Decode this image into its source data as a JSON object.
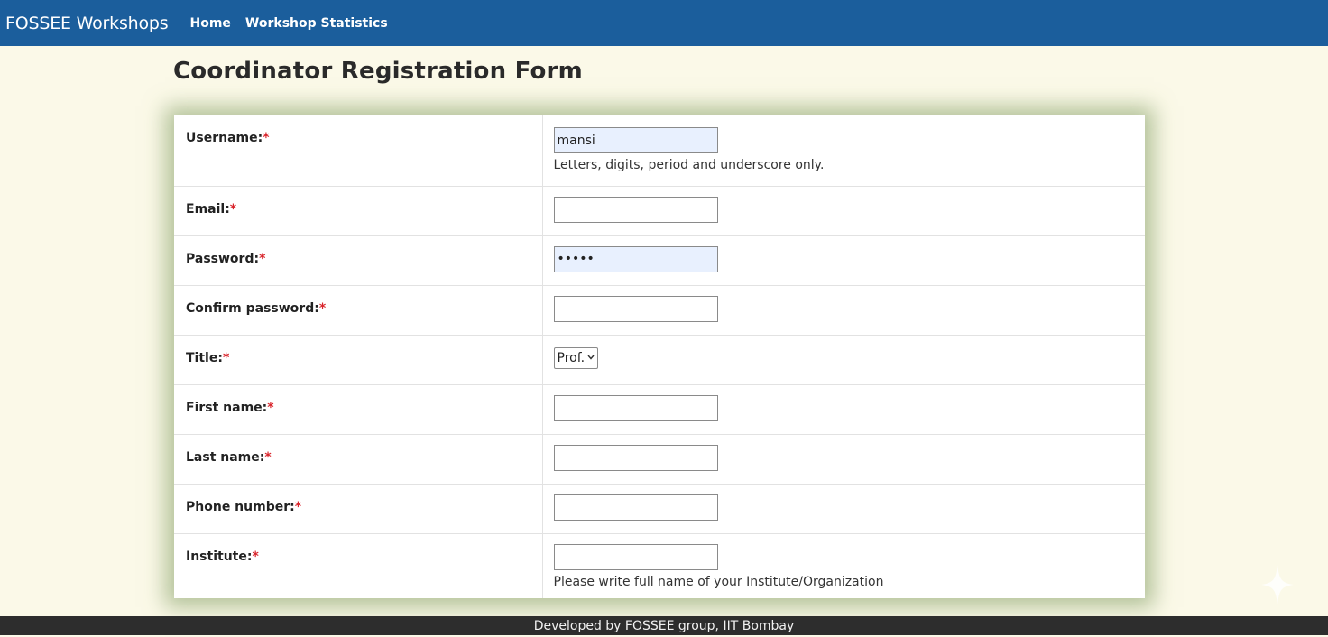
{
  "navbar": {
    "brand": "FOSSEE Workshops",
    "links": [
      "Home",
      "Workshop Statistics"
    ]
  },
  "page": {
    "title": "Coordinator Registration Form"
  },
  "form": {
    "required_mark": "*",
    "fields": [
      {
        "label": "Username:",
        "value": "mansi",
        "help": "Letters, digits, period and underscore only."
      },
      {
        "label": "Email:",
        "value": ""
      },
      {
        "label": "Password:",
        "value": "•••••"
      },
      {
        "label": "Confirm password:",
        "value": ""
      },
      {
        "label": "Title:",
        "selected": "Prof."
      },
      {
        "label": "First name:",
        "value": ""
      },
      {
        "label": "Last name:",
        "value": ""
      },
      {
        "label": "Phone number:",
        "value": ""
      },
      {
        "label": "Institute:",
        "value": "",
        "help": "Please write full name of your Institute/Organization"
      }
    ]
  },
  "footer": {
    "text": "Developed by FOSSEE group, IIT Bombay"
  },
  "colors": {
    "navbar": "#1b5e9c",
    "page_bg": "#fbf9e8",
    "required": "#d9242b",
    "autofill": "#e8f0fe",
    "footer": "#2d2d2d"
  }
}
